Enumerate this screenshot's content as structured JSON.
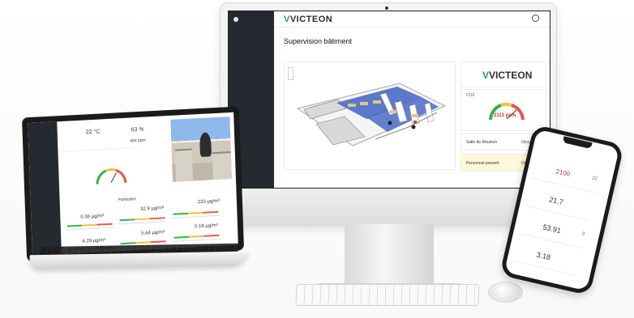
{
  "desktop": {
    "logo_text": "VICTEON",
    "logo_mark": "V",
    "sidebar_brand": "",
    "sidebar_items": [
      "",
      "",
      "",
      "",
      "",
      "",
      "",
      "",
      "",
      "",
      "",
      "",
      ""
    ],
    "breadcrumbs": [
      "",
      ""
    ],
    "user_name": "",
    "page_title": "Supervision bâtiment",
    "tabs": [
      "",
      "",
      "",
      ""
    ],
    "right_logo_text": "VICTEON",
    "right_logo_mark": "V",
    "co2": {
      "label": "CO2",
      "value": "2113 ppm",
      "small_note": ""
    },
    "status_cards": [
      {
        "label": "Salle de Réunion",
        "value": "Occupée",
        "color": "#d93a3a"
      },
      {
        "label": "Personnel présent",
        "value": "Occupée",
        "color": "#f2cf45",
        "subtext": ""
      }
    ]
  },
  "laptop": {
    "sidebar_items": [
      "",
      "",
      "",
      "",
      "",
      "",
      "",
      "",
      "",
      "",
      ""
    ],
    "temperature": "22 °C",
    "humidity": "63 %",
    "co2_value": "400 ppm",
    "section_title": "Particules",
    "metrics": [
      {
        "value": "0.36 µg/m³"
      },
      {
        "value": "32.9 µg/m³"
      },
      {
        "value": "220 µg/m³"
      },
      {
        "value": "4.29 µg/m³"
      },
      {
        "value": "5.64 µg/m³"
      },
      {
        "value": "0.18 µg/m³"
      }
    ]
  },
  "phone": {
    "title": "",
    "cards": [
      {
        "label": "",
        "value": "2100",
        "side": "22"
      },
      {
        "label": "",
        "value": "21.7",
        "side": ""
      },
      {
        "label": "",
        "value": "53.91",
        "side": "0"
      },
      {
        "label": "",
        "value": "3.18",
        "side": ""
      }
    ]
  },
  "colors": {
    "brand_green": "#25a25a",
    "dark_sidebar": "#252a31",
    "alert_red": "#d93a3a",
    "warning_yellow": "#f2cf45"
  }
}
